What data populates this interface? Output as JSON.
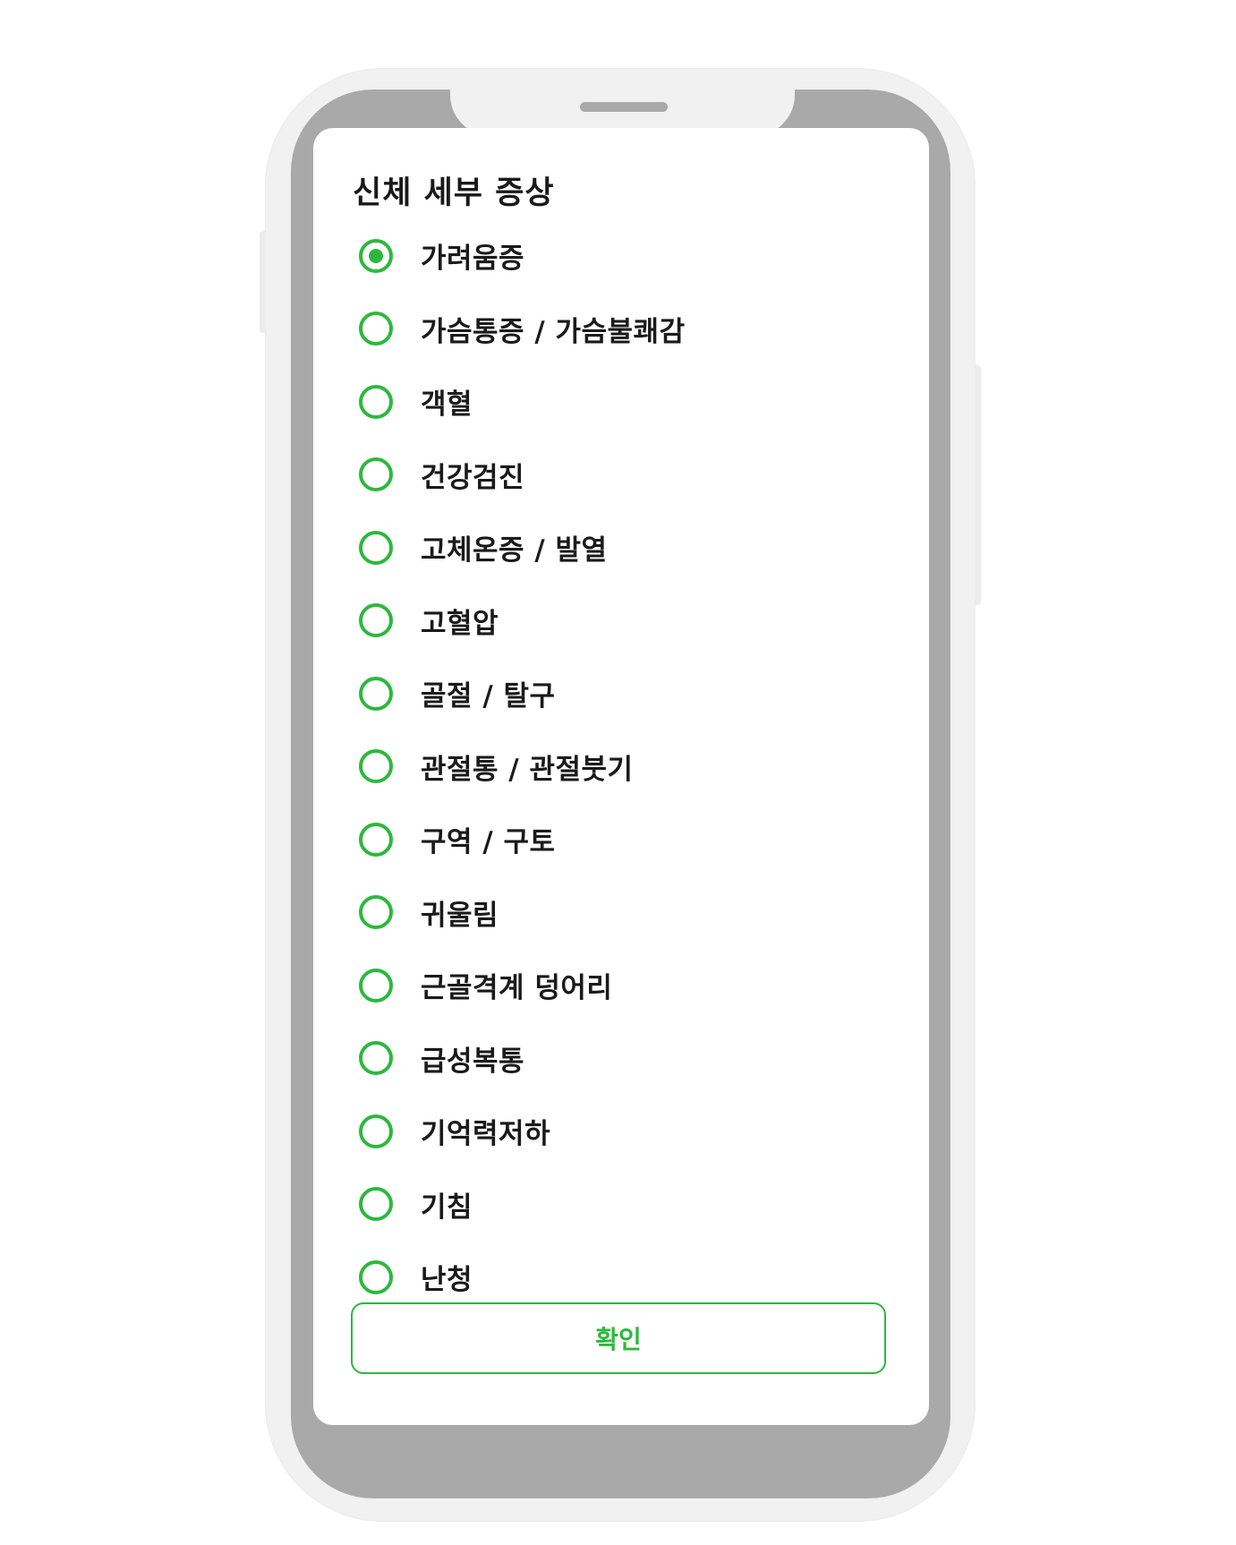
{
  "page": {
    "title": "신체 세부 증상"
  },
  "options": [
    {
      "label": "가려움증",
      "selected": true
    },
    {
      "label": "가슴통증 / 가슴불쾌감",
      "selected": false
    },
    {
      "label": "객혈",
      "selected": false
    },
    {
      "label": "건강검진",
      "selected": false
    },
    {
      "label": "고체온증 / 발열",
      "selected": false
    },
    {
      "label": "고혈압",
      "selected": false
    },
    {
      "label": "골절 / 탈구",
      "selected": false
    },
    {
      "label": "관절통 / 관절붓기",
      "selected": false
    },
    {
      "label": "구역 / 구토",
      "selected": false
    },
    {
      "label": "귀울림",
      "selected": false
    },
    {
      "label": "근골격계 덩어리",
      "selected": false
    },
    {
      "label": "급성복통",
      "selected": false
    },
    {
      "label": "기억력저하",
      "selected": false
    },
    {
      "label": "기침",
      "selected": false
    },
    {
      "label": "난청",
      "selected": false
    }
  ],
  "confirm_button": {
    "label": "확인"
  },
  "colors": {
    "accent": "#2db83d",
    "bezel": "#a9a9a9",
    "shell": "#f1f1f1",
    "text": "#1a1a1a"
  }
}
